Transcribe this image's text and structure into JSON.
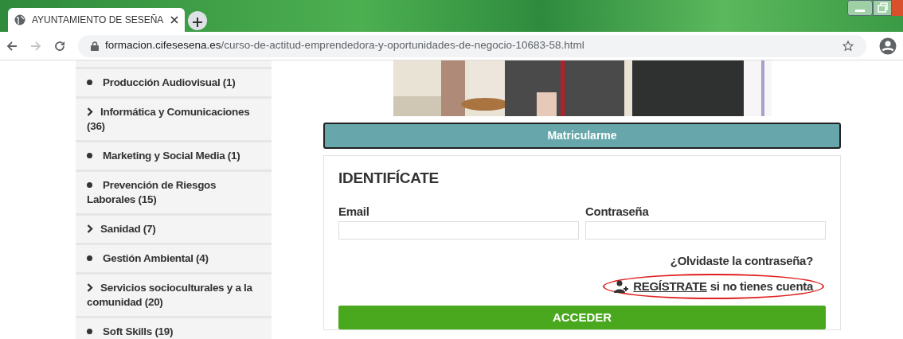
{
  "browser": {
    "tab": {
      "title": "AYUNTAMIENTO DE SESEÑA"
    },
    "forward_disabled": true,
    "url": {
      "domain": "formacion.cifesesena.es",
      "path": "/curso-de-actitud-emprendedora-y-oportunidades-de-negocio-10683-58.html"
    }
  },
  "sidebar": {
    "items": [
      {
        "label": "Producción Audiovisual (1)",
        "kind": "leaf"
      },
      {
        "label": "Informática y Comunicaciones (36)",
        "kind": "group"
      },
      {
        "label": "Marketing y Social Media (1)",
        "kind": "leaf"
      },
      {
        "label": "Prevención de Riesgos Laborales (15)",
        "kind": "leaf"
      },
      {
        "label": "Sanidad (7)",
        "kind": "group"
      },
      {
        "label": "Gestión Ambiental (4)",
        "kind": "leaf"
      },
      {
        "label": "Servicios socioculturales y a la comunidad (20)",
        "kind": "group"
      },
      {
        "label": "Soft Skills (19)",
        "kind": "leaf"
      }
    ]
  },
  "enroll_button": "Matricularme",
  "login": {
    "title": "IDENTIFÍCATE",
    "fields": [
      {
        "label": "Email"
      },
      {
        "label": "Contraseña"
      }
    ],
    "forgot_link": "¿Olvidaste la contraseña?",
    "register": {
      "link": "REGÍSTRATE",
      "text": " si no tienes cuenta"
    },
    "submit": "ACCEDER"
  }
}
